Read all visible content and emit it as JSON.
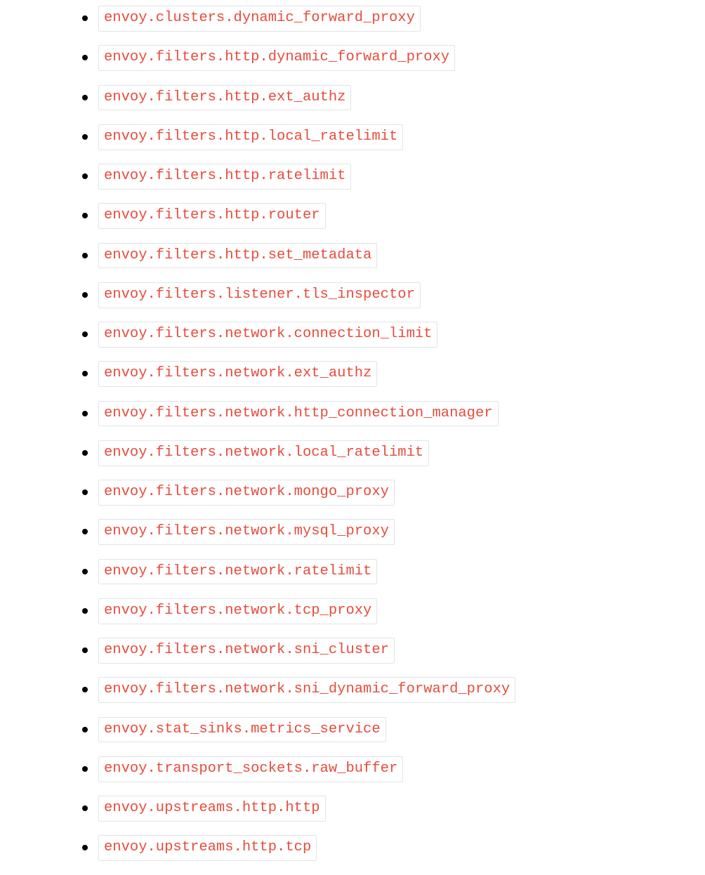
{
  "extensions": [
    "envoy.clusters.dynamic_forward_proxy",
    "envoy.filters.http.dynamic_forward_proxy",
    "envoy.filters.http.ext_authz",
    "envoy.filters.http.local_ratelimit",
    "envoy.filters.http.ratelimit",
    "envoy.filters.http.router",
    "envoy.filters.http.set_metadata",
    "envoy.filters.listener.tls_inspector",
    "envoy.filters.network.connection_limit",
    "envoy.filters.network.ext_authz",
    "envoy.filters.network.http_connection_manager",
    "envoy.filters.network.local_ratelimit",
    "envoy.filters.network.mongo_proxy",
    "envoy.filters.network.mysql_proxy",
    "envoy.filters.network.ratelimit",
    "envoy.filters.network.tcp_proxy",
    "envoy.filters.network.sni_cluster",
    "envoy.filters.network.sni_dynamic_forward_proxy",
    "envoy.stat_sinks.metrics_service",
    "envoy.transport_sockets.raw_buffer",
    "envoy.upstreams.http.http",
    "envoy.upstreams.http.tcp"
  ]
}
